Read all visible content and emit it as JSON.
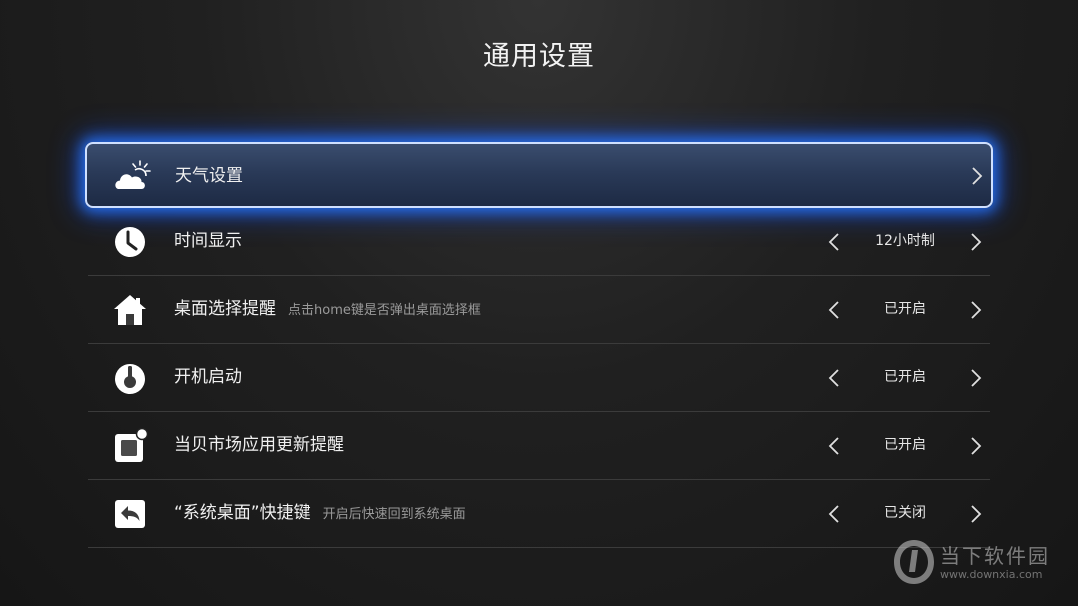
{
  "title": "通用设置",
  "items": [
    {
      "label": "天气设置",
      "description": "",
      "value": "",
      "icon": "weather-icon"
    },
    {
      "label": "时间显示",
      "description": "",
      "value": "12小时制",
      "icon": "clock-icon"
    },
    {
      "label": "桌面选择提醒",
      "description": "点击home键是否弹出桌面选择框",
      "value": "已开启",
      "icon": "home-icon"
    },
    {
      "label": "开机启动",
      "description": "",
      "value": "已开启",
      "icon": "power-icon"
    },
    {
      "label": "当贝市场应用更新提醒",
      "description": "",
      "value": "已开启",
      "icon": "update-notification-icon"
    },
    {
      "label": "“系统桌面”快捷键",
      "description": "开启后快速回到系统桌面",
      "value": "已关闭",
      "icon": "back-arrow-icon"
    }
  ],
  "watermark": {
    "name": "当下软件园",
    "url": "www.downxia.com"
  },
  "colors": {
    "focus_glow": "#2878ff",
    "focus_border": "#cfe0ff",
    "divider": "#3b3b3b",
    "description_text": "#9a9a9a"
  }
}
